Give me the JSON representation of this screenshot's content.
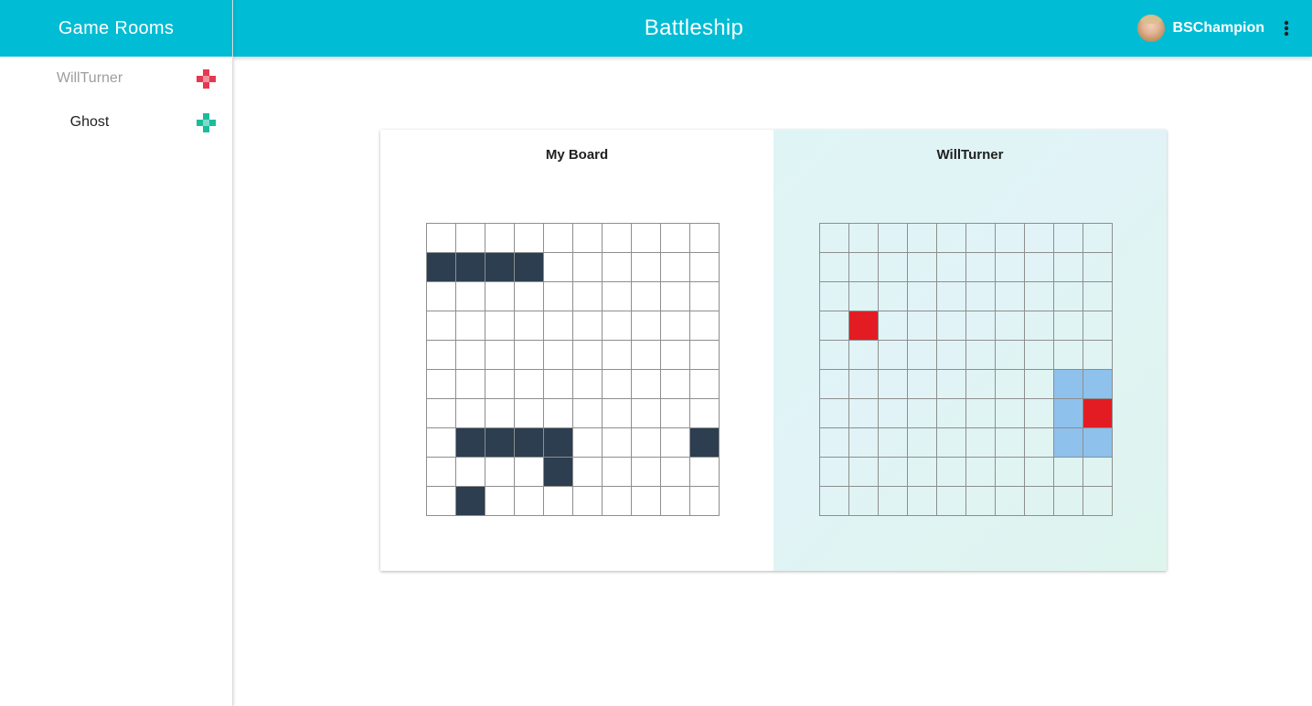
{
  "sidebar": {
    "title": "Game Rooms",
    "rooms": [
      {
        "name": "WillTurner",
        "state": "inactive",
        "icon": "gamepad-icon",
        "icon_color": "#e53950"
      },
      {
        "name": "Ghost",
        "state": "active",
        "icon": "gamepad-icon",
        "icon_color": "#1abc9c"
      }
    ]
  },
  "header": {
    "title": "Battleship",
    "user": {
      "name": "BSChampion",
      "avatar": "user-avatar"
    },
    "menu_icon": "more-vert-icon"
  },
  "colors": {
    "accent": "#00bcd4",
    "ship": "#2c3e50",
    "hit": "#e31c23",
    "miss": "#8ec1ec"
  },
  "boards": {
    "mine": {
      "title": "My Board",
      "rows": [
        "..........",
        "SSSS......",
        "..........",
        "..........",
        "..........",
        "..........",
        "..........",
        ".SSSS....S",
        "....S.....",
        ".S........"
      ]
    },
    "opponent": {
      "title": "WillTurner",
      "rows": [
        "..........",
        "..........",
        "..........",
        ".H........",
        "..........",
        "........MM",
        "........MH",
        "........MM",
        "..........",
        ".........."
      ]
    }
  }
}
